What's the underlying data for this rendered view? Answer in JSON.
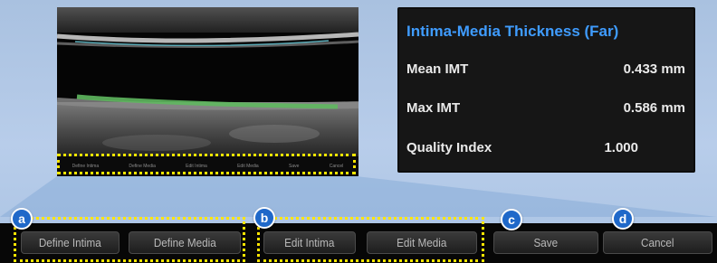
{
  "ultrasound": {
    "mini_buttons": [
      "Define Intima",
      "Define Media",
      "Edit Intima",
      "Edit Media",
      "Save",
      "Cancel"
    ]
  },
  "results": {
    "title": "Intima-Media Thickness (Far)",
    "rows": [
      {
        "label": "Mean IMT",
        "value": "0.433",
        "unit": "mm"
      },
      {
        "label": "Max IMT",
        "value": "0.586",
        "unit": "mm"
      },
      {
        "label": "Quality Index",
        "value": "1.000",
        "unit": ""
      }
    ]
  },
  "toolbar": {
    "define_intima": "Define Intima",
    "define_media": "Define Media",
    "edit_intima": "Edit Intima",
    "edit_media": "Edit Media",
    "save": "Save",
    "cancel": "Cancel"
  },
  "badges": {
    "a": "a",
    "b": "b",
    "c": "c",
    "d": "d"
  },
  "colors": {
    "highlight": "#ffe600",
    "title_blue": "#3f9cff",
    "badge_blue": "#1f68c9",
    "intima_trace": "#5fb85f",
    "media_trace": "#59a9b5"
  }
}
